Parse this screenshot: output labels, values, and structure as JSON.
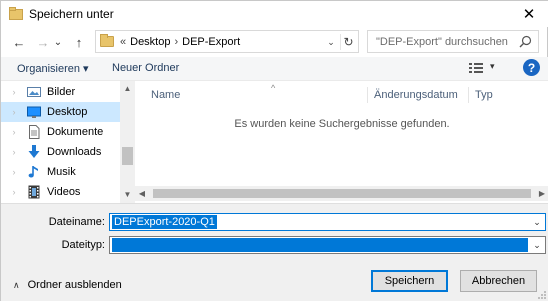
{
  "window": {
    "title": "Speichern unter",
    "close_glyph": "✕"
  },
  "nav": {
    "back_glyph": "←",
    "forward_glyph": "→",
    "recent_glyph": "⌄",
    "up_glyph": "↑",
    "breadcrumb_overflow": "«",
    "breadcrumbs": [
      "Desktop",
      "DEP-Export"
    ],
    "crumb_separator": "›",
    "address_dropdown_glyph": "⌄",
    "refresh_glyph": "↻",
    "search_placeholder": "\"DEP-Export\" durchsuchen"
  },
  "toolbar": {
    "organize_label": "Organisieren ▾",
    "new_folder_label": "Neuer Ordner",
    "view_caret": "▾",
    "help_label": "?"
  },
  "sidebar": {
    "items": [
      {
        "label": "Bilder",
        "icon": "pictures-icon",
        "selected": false
      },
      {
        "label": "Desktop",
        "icon": "desktop-icon",
        "selected": true
      },
      {
        "label": "Dokumente",
        "icon": "documents-icon",
        "selected": false
      },
      {
        "label": "Downloads",
        "icon": "downloads-icon",
        "selected": false
      },
      {
        "label": "Musik",
        "icon": "music-icon",
        "selected": false
      },
      {
        "label": "Videos",
        "icon": "videos-icon",
        "selected": false
      }
    ],
    "expand_glyph": "›"
  },
  "filelist": {
    "columns": [
      "Name",
      "Änderungsdatum",
      "Typ"
    ],
    "sort_glyph": "^",
    "empty_message": "Es wurden keine Suchergebnisse gefunden."
  },
  "form": {
    "filename_label": "Dateiname:",
    "filename_value": "DEPExport-2020-Q1",
    "filetype_label": "Dateityp:",
    "filetype_value": "",
    "hide_folders_label": "Ordner ausblenden",
    "save_label": "Speichern",
    "cancel_label": "Abbrechen"
  },
  "colors": {
    "accent": "#0078d7",
    "selection": "#cce8ff",
    "help": "#1a66c2"
  }
}
